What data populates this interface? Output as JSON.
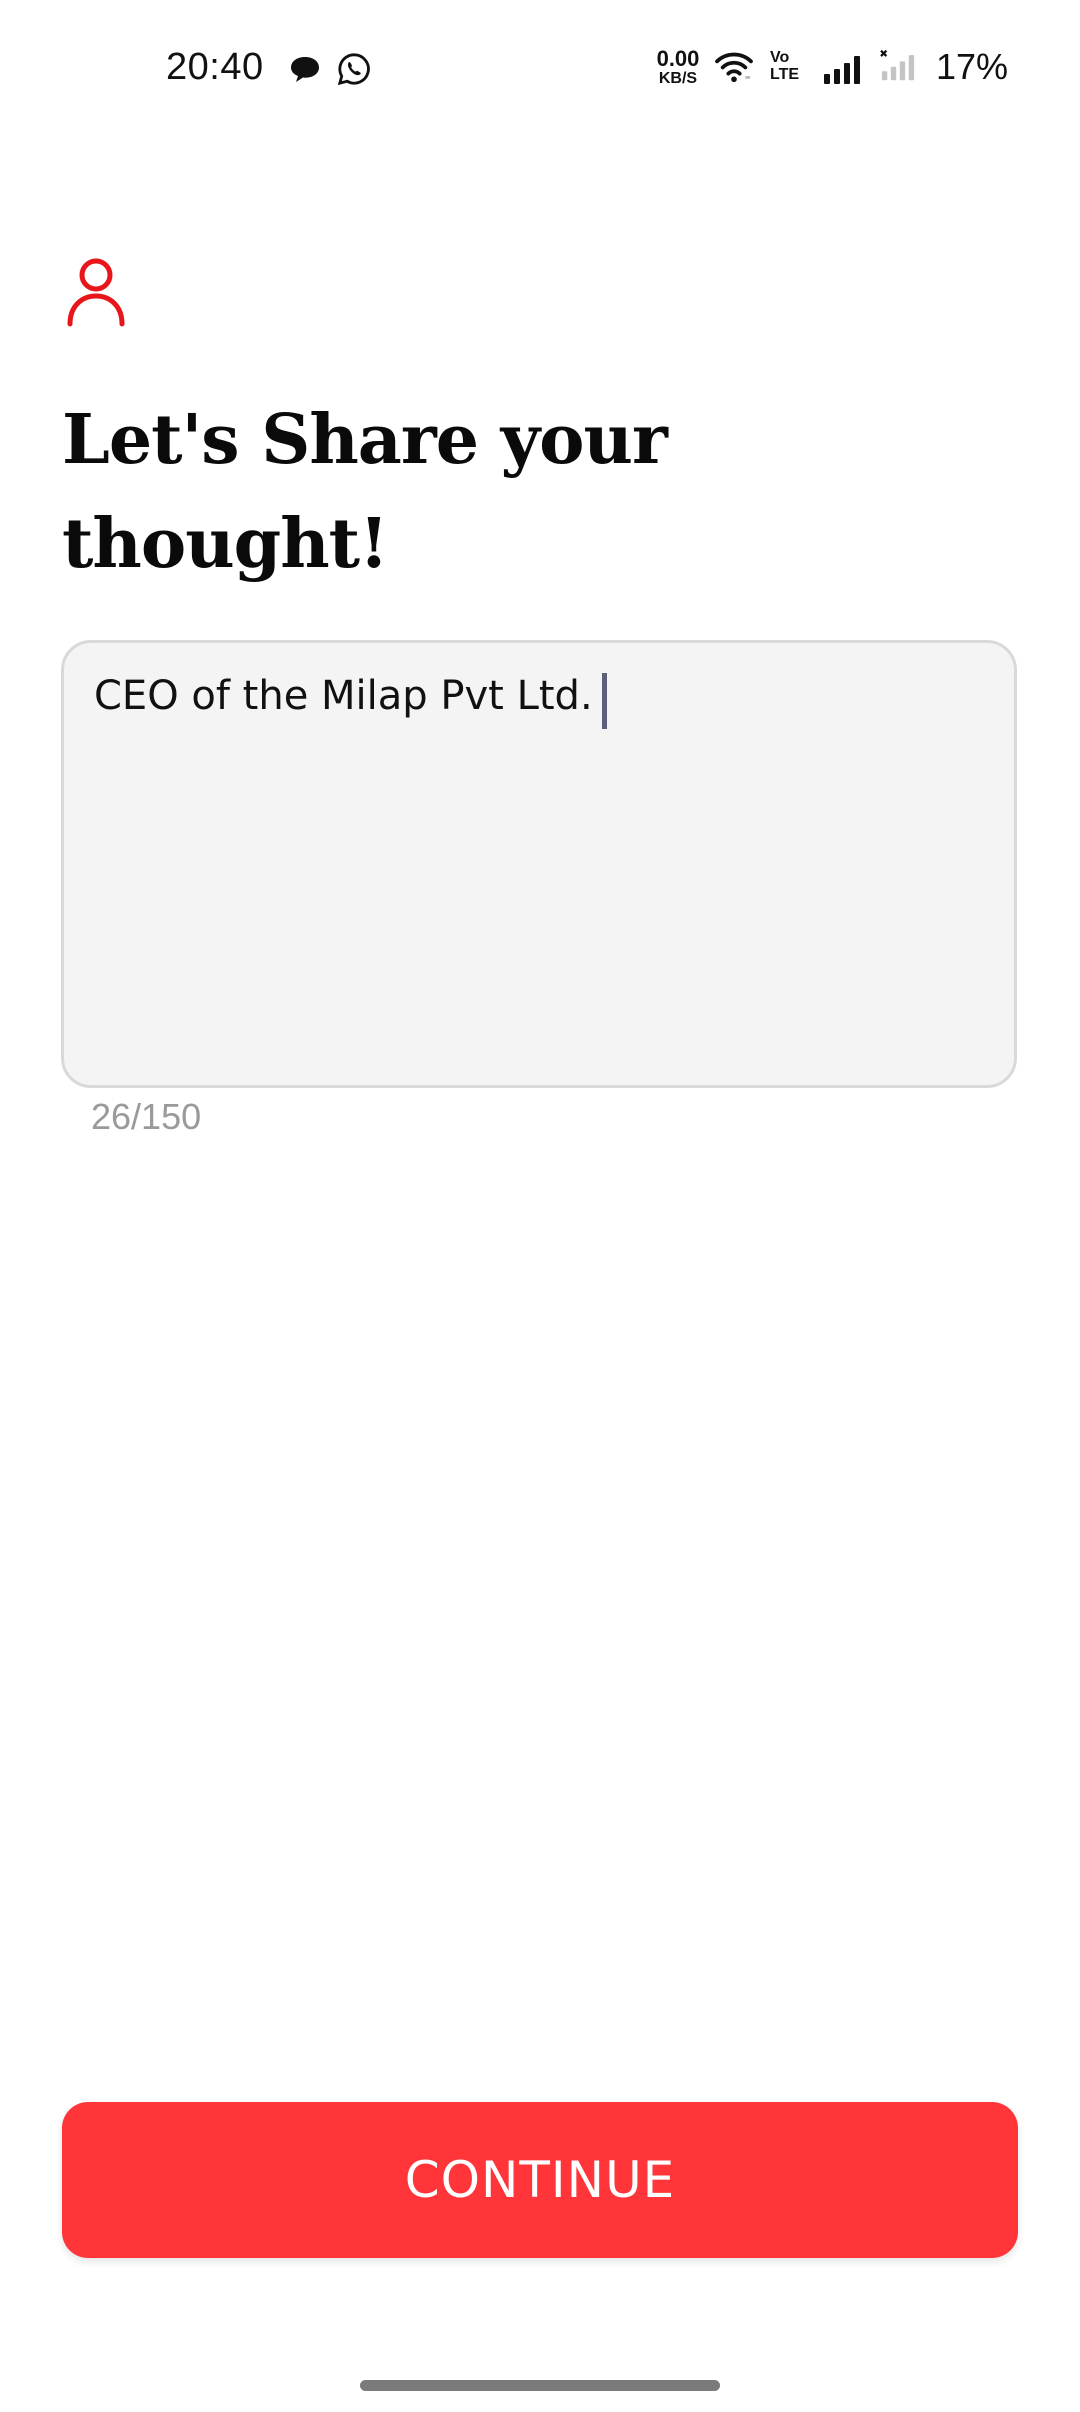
{
  "status_bar": {
    "time": "20:40",
    "notification_icons": [
      "chat-bubble-icon",
      "whatsapp-icon"
    ],
    "net_speed_value": "0.00",
    "net_speed_unit": "KB/S",
    "volte_label_top": "Vo",
    "volte_label_bottom": "LTE",
    "system_icons": [
      "wifi-icon",
      "volte-icon",
      "signal-icon",
      "signal-no-service-icon"
    ],
    "battery": "17%"
  },
  "header": {
    "icon": "user-icon",
    "accent_color": "#e8161b",
    "title_line1": "Let's Share your",
    "title_line2": "thought!"
  },
  "thought": {
    "value": "CEO of the Milap Pvt Ltd. ",
    "char_count": "26/150"
  },
  "actions": {
    "continue_label": "CONTINUE",
    "continue_color": "#ff3539"
  }
}
